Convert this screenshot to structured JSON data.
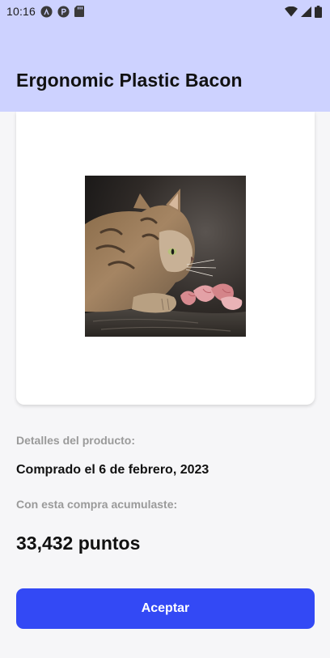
{
  "status_bar": {
    "time": "10:16",
    "icons": [
      "a-circle-icon",
      "p-circle-icon",
      "sd-card-icon",
      "wifi-icon",
      "cell-signal-icon",
      "battery-icon"
    ]
  },
  "header": {
    "title": "Ergonomic Plastic Bacon",
    "background_color": "#cdd2ff"
  },
  "product": {
    "image_alt": "cat-photo"
  },
  "details": {
    "section_label": "Detalles del producto:",
    "purchase_date": "Comprado el 6 de febrero, 2023",
    "points_label": "Con esta compra acumulaste:",
    "points_value": "33,432 puntos"
  },
  "actions": {
    "accept_label": "Aceptar",
    "accent_color": "#3349f5"
  }
}
